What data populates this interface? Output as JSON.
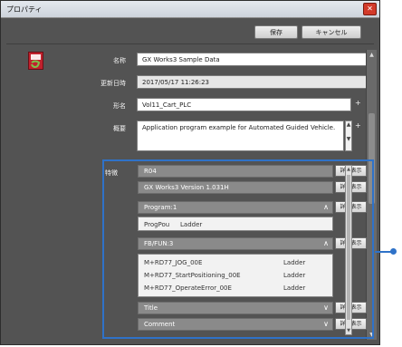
{
  "window": {
    "title": "プロパティ",
    "close": "✕"
  },
  "toolbar": {
    "save_label": "保存",
    "cancel_label": "キャンセル"
  },
  "form": {
    "name_label": "名称",
    "name_value": "GX Works3 Sample Data",
    "updated_label": "更新日時",
    "updated_value": "2017/05/17 11:26:23",
    "title_label": "形名",
    "title_value": "Vol11_Cart_PLC",
    "summary_label": "概要",
    "summary_value": "Application program example for Automated Guided Vehicle."
  },
  "details": {
    "label": "特徴",
    "detail_button": "詳細表示",
    "sections": [
      {
        "title": "R04",
        "chevron": ""
      },
      {
        "title": "GX Works3 Version 1.031H",
        "chevron": ""
      },
      {
        "title": "Program:1",
        "chevron": "∧"
      },
      {
        "title": "FB/FUN:3",
        "chevron": "∧"
      },
      {
        "title": "Title",
        "chevron": "∨"
      },
      {
        "title": "Comment",
        "chevron": "∨"
      }
    ],
    "program_rows": [
      {
        "name": "ProgPou",
        "type": "Ladder"
      }
    ],
    "fb_rows": [
      {
        "name": "M+RD77_JOG_00E",
        "type": "Ladder"
      },
      {
        "name": "M+RD77_StartPositioning_00E",
        "type": "Ladder"
      },
      {
        "name": "M+RD77_OperateError_00E",
        "type": "Ladder"
      }
    ]
  },
  "colors": {
    "accent": "#2f72c8",
    "window_bg": "#535353",
    "bar_bg": "#8a8a8a",
    "logo": "#c0212d"
  },
  "icons": {
    "logo": "gx-works3-logo",
    "close": "close-icon"
  }
}
